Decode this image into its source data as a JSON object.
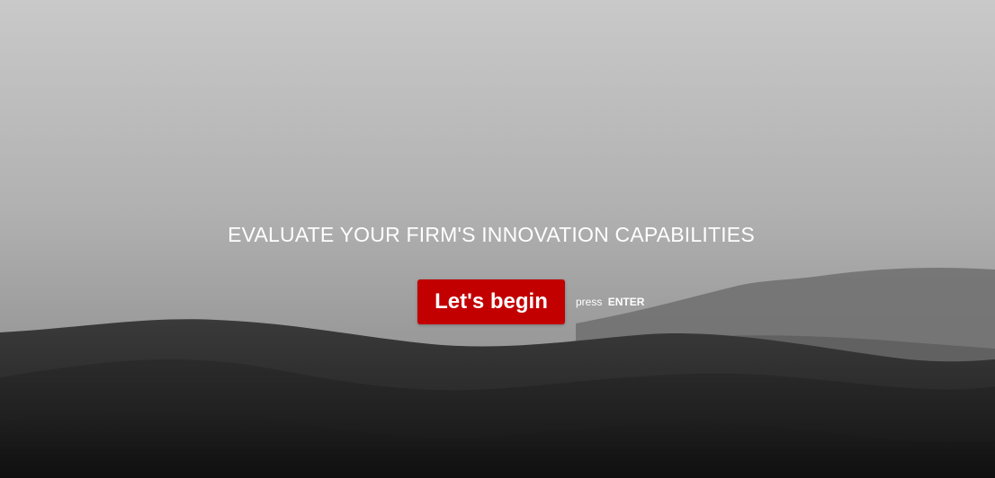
{
  "intro": {
    "headline": "EVALUATE YOUR FIRM'S INNOVATION CAPABILITIES",
    "button_label": "Let's begin",
    "hint_prefix": "press",
    "hint_key": "ENTER"
  },
  "colors": {
    "button": "#c20000",
    "text": "#ffffff"
  }
}
